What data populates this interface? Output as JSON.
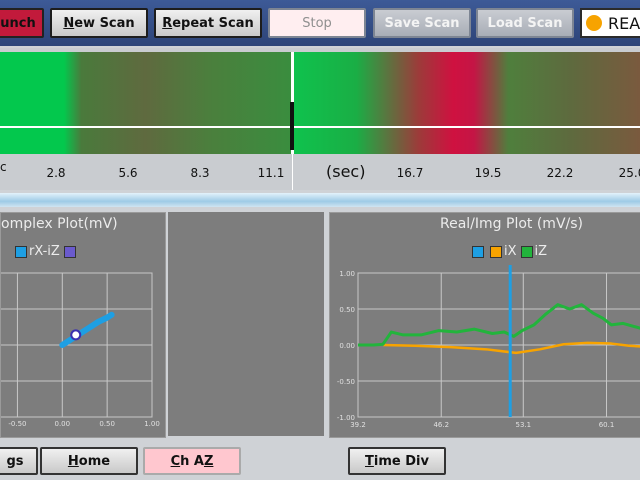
{
  "toolbar": {
    "launch_label": "unch",
    "new_scan_first": "N",
    "new_scan_rest": "ew Scan",
    "repeat_scan_first": "R",
    "repeat_scan_rest": "epeat Scan",
    "stop_label": "Stop",
    "save_scan_label": "Save Scan",
    "load_scan_label": "Load Scan",
    "status_text": "REA",
    "status_color": "#f7a300"
  },
  "strip": {
    "left_label_fragment": "c",
    "left_ticks": [
      "2.8",
      "5.6",
      "8.3",
      "11.1"
    ],
    "unit_label": "(sec)",
    "right_ticks": [
      "16.7",
      "19.5",
      "22.2",
      "25.0"
    ]
  },
  "complex_plot": {
    "title": "omplex Plot(mV)",
    "legend_label": "rX-iZ",
    "legend_colors": [
      "#1e9fe3",
      "#6a5acd"
    ],
    "x_ticks": [
      "-0.50",
      "0.00",
      "0.50",
      "1.00"
    ]
  },
  "realimg_plot": {
    "title": "Real/Img Plot (mV/s)",
    "legend": [
      {
        "label": "",
        "color": "#1e9fe3"
      },
      {
        "label": "iX",
        "color": "#f7a300"
      },
      {
        "label": "iZ",
        "color": "#22b43c"
      }
    ],
    "y_ticks": [
      "1.00",
      "0.50",
      "0.00",
      "-0.50",
      "-1.00"
    ],
    "x_ticks": [
      "39.2",
      "46.2",
      "53.1",
      "60.1"
    ]
  },
  "bottom": {
    "settings_label": "gs",
    "home_first": "H",
    "home_rest": "ome",
    "chaz_first": "C",
    "chaz_mid": "h A",
    "chaz_last": "Z",
    "timediv_first": "T",
    "timediv_rest": "ime Div"
  },
  "chart_data": [
    {
      "type": "scatter",
      "title": "omplex Plot(mV)",
      "legend": [
        "rX-iZ"
      ],
      "xlim": [
        -0.75,
        1.0
      ],
      "ylim": [
        -1.0,
        1.0
      ],
      "x_ticks": [
        "-0.50",
        "0.00",
        "0.50",
        "1.00"
      ],
      "series": [
        {
          "name": "rX-iZ",
          "color": "#1e9fe3",
          "x": [
            0.0,
            0.1,
            0.2,
            0.3,
            0.4,
            0.5,
            0.55
          ],
          "y": [
            0.0,
            0.08,
            0.16,
            0.24,
            0.32,
            0.38,
            0.42
          ]
        }
      ],
      "marker": {
        "x": 0.15,
        "y": 0.14
      }
    },
    {
      "type": "line",
      "title": "Real/Img Plot (mV/s)",
      "legend": [
        "iX",
        "iZ"
      ],
      "xlim": [
        39.2,
        63.0
      ],
      "ylim": [
        -1.0,
        1.0
      ],
      "x_ticks": [
        "39.2",
        "46.2",
        "53.1",
        "60.1"
      ],
      "y_ticks": [
        "1.00",
        "0.50",
        "0.00",
        "-0.50",
        "-1.00"
      ],
      "cursor_x": 52.0,
      "series": [
        {
          "name": "iX",
          "color": "#f7a300",
          "x": [
            41.3,
            44.0,
            47.0,
            50.0,
            52.5,
            54.5,
            56.5,
            58.5,
            60.5,
            62.0,
            63.0
          ],
          "y": [
            0.0,
            -0.01,
            -0.03,
            -0.06,
            -0.11,
            -0.06,
            0.01,
            0.03,
            0.02,
            -0.01,
            -0.02
          ]
        },
        {
          "name": "iZ",
          "color": "#22b43c",
          "x": [
            39.2,
            40.5,
            41.3,
            42.0,
            43.0,
            44.5,
            46.0,
            47.5,
            49.0,
            50.5,
            51.5,
            52.3,
            53.0,
            54.0,
            55.0,
            56.0,
            57.0,
            58.0,
            59.0,
            59.8,
            60.5,
            61.5,
            63.0
          ],
          "y": [
            0.0,
            0.0,
            0.01,
            0.18,
            0.14,
            0.14,
            0.2,
            0.18,
            0.22,
            0.16,
            0.18,
            0.12,
            0.2,
            0.28,
            0.43,
            0.56,
            0.5,
            0.56,
            0.44,
            0.37,
            0.28,
            0.3,
            0.23
          ]
        }
      ]
    }
  ]
}
